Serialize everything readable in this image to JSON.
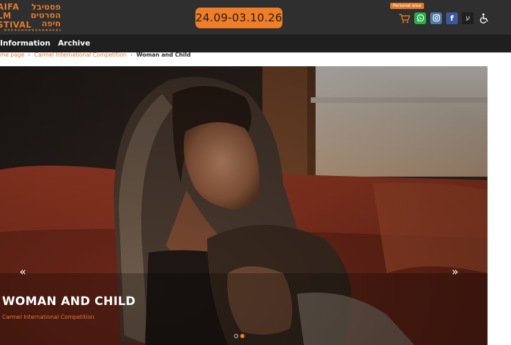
{
  "header": {
    "logo": {
      "latin_lines": [
        "AIFA",
        "LM",
        "STIVAL"
      ],
      "hebrew_lines": [
        "פסטיבל",
        "הסרטים",
        "חיפה"
      ]
    },
    "dates": "24.09-03.10.26",
    "personal_label": "Personal area",
    "icons": [
      "cart-icon",
      "whatsapp-icon",
      "instagram-icon",
      "facebook-icon",
      "hebrew-language-icon",
      "accessibility-icon"
    ],
    "facebook_glyph": "f",
    "hebrew_glyph": "ע"
  },
  "nav": {
    "items": [
      "Information",
      "Archive"
    ]
  },
  "breadcrumb": {
    "items": [
      "me page",
      "Carmel International Competition",
      "Woman and Child"
    ],
    "separator": "›"
  },
  "hero": {
    "title": "WOMAN AND CHILD",
    "subtitle": "Carmel International Competition",
    "prev_glyph": "«",
    "next_glyph": "»",
    "slide_count": 2,
    "active_slide": 2
  },
  "colors": {
    "accent": "#f07d27",
    "header_bg": "#2f2f2f",
    "nav_bg": "#1f1f1f"
  }
}
